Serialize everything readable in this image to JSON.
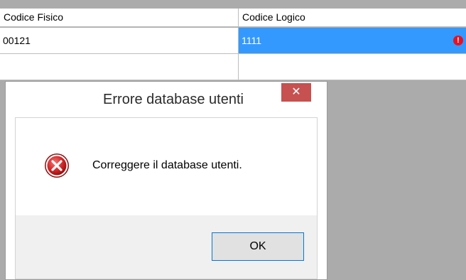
{
  "grid": {
    "columns": [
      "Codice Fisico",
      "Codice Logico"
    ],
    "rows": [
      {
        "fisico": "00121",
        "logico": "1111"
      },
      {
        "fisico": "",
        "logico": ""
      }
    ]
  },
  "dialog": {
    "title": "Errore database utenti",
    "close_label": "✕",
    "message": "Correggere il database utenti.",
    "ok_label": "OK"
  },
  "colors": {
    "selection": "#3399ff",
    "error": "#e81123",
    "close": "#c75050"
  }
}
